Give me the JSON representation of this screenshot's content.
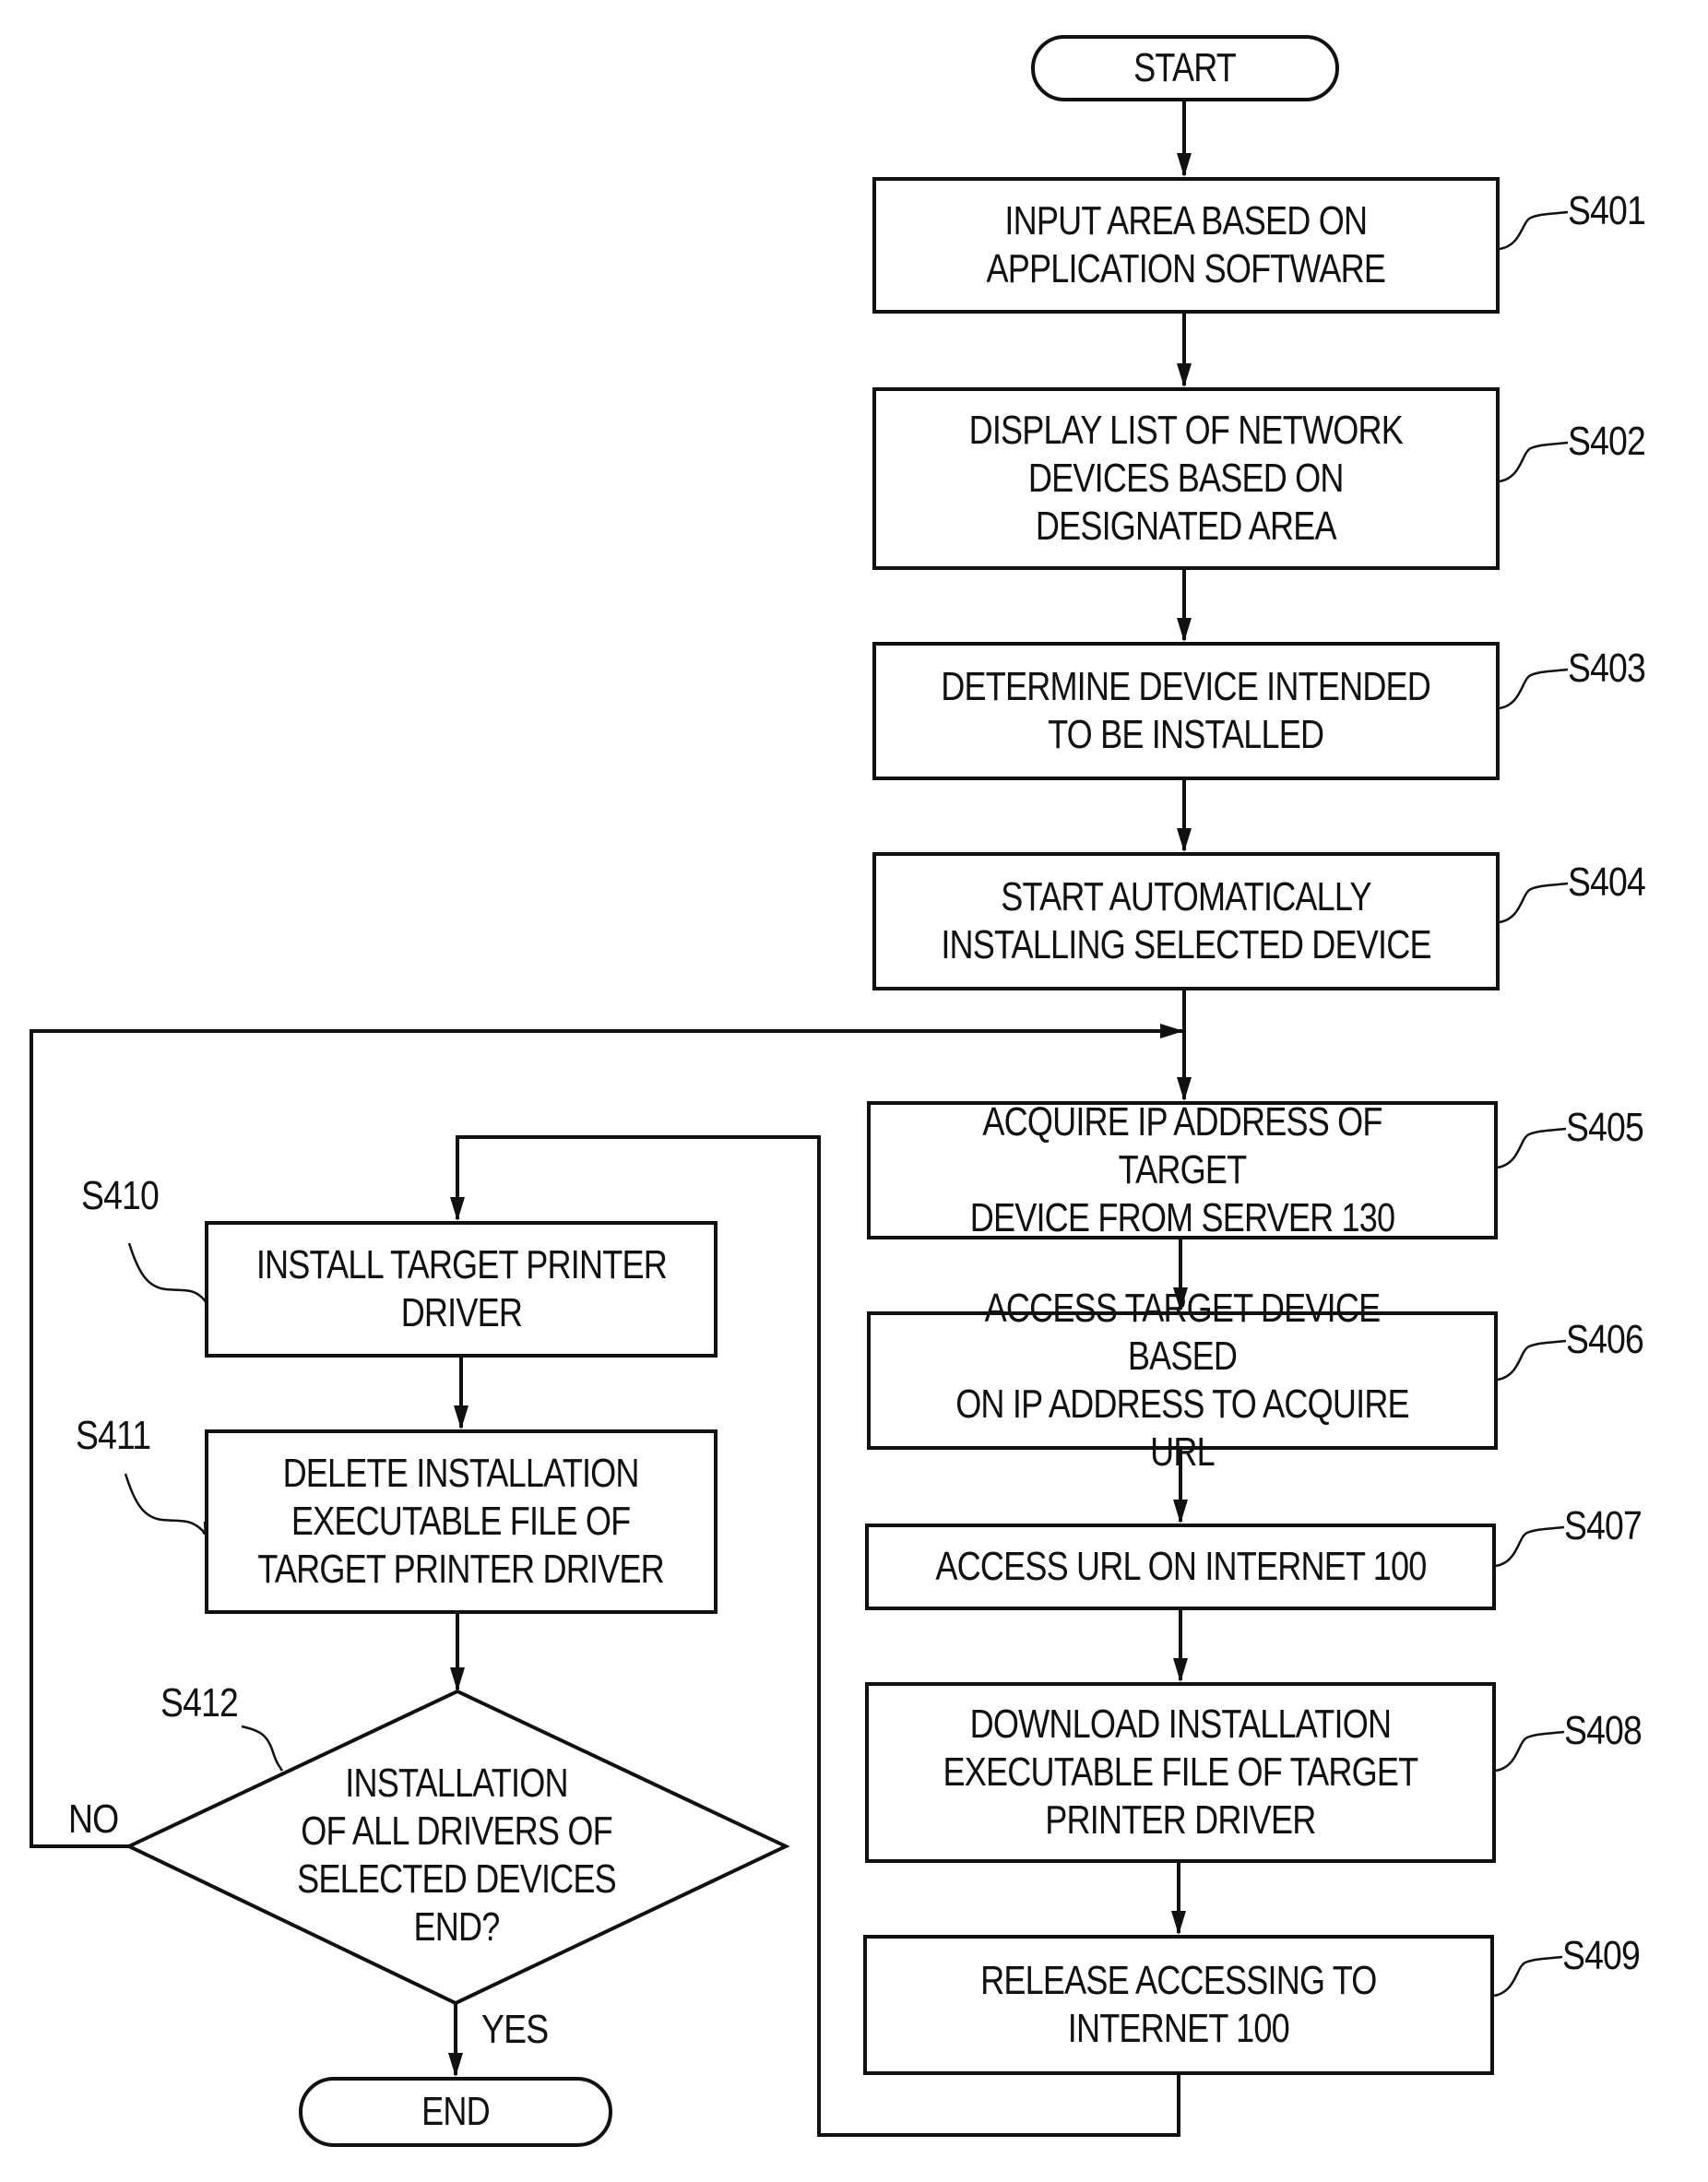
{
  "flowchart": {
    "start": "START",
    "end": "END",
    "steps": [
      {
        "id": "S401",
        "text": "INPUT AREA BASED ON\nAPPLICATION SOFTWARE"
      },
      {
        "id": "S402",
        "text": "DISPLAY LIST OF NETWORK\nDEVICES BASED ON\nDESIGNATED AREA"
      },
      {
        "id": "S403",
        "text": "DETERMINE DEVICE INTENDED\nTO BE INSTALLED"
      },
      {
        "id": "S404",
        "text": "START AUTOMATICALLY\nINSTALLING SELECTED DEVICE"
      },
      {
        "id": "S405",
        "text": "ACQUIRE IP ADDRESS OF TARGET\nDEVICE FROM SERVER 130"
      },
      {
        "id": "S406",
        "text": "ACCESS TARGET DEVICE BASED\nON IP ADDRESS TO ACQUIRE URL"
      },
      {
        "id": "S407",
        "text": "ACCESS URL ON INTERNET 100"
      },
      {
        "id": "S408",
        "text": "DOWNLOAD INSTALLATION\nEXECUTABLE FILE OF TARGET\nPRINTER DRIVER"
      },
      {
        "id": "S409",
        "text": "RELEASE ACCESSING TO\nINTERNET 100"
      },
      {
        "id": "S410",
        "text": "INSTALL TARGET PRINTER\nDRIVER"
      },
      {
        "id": "S411",
        "text": "DELETE INSTALLATION\nEXECUTABLE FILE OF\nTARGET PRINTER DRIVER"
      }
    ],
    "decision": {
      "id": "S412",
      "text": "INSTALLATION\nOF ALL DRIVERS OF\nSELECTED DEVICES\nEND?",
      "no": "NO",
      "yes": "YES"
    }
  }
}
